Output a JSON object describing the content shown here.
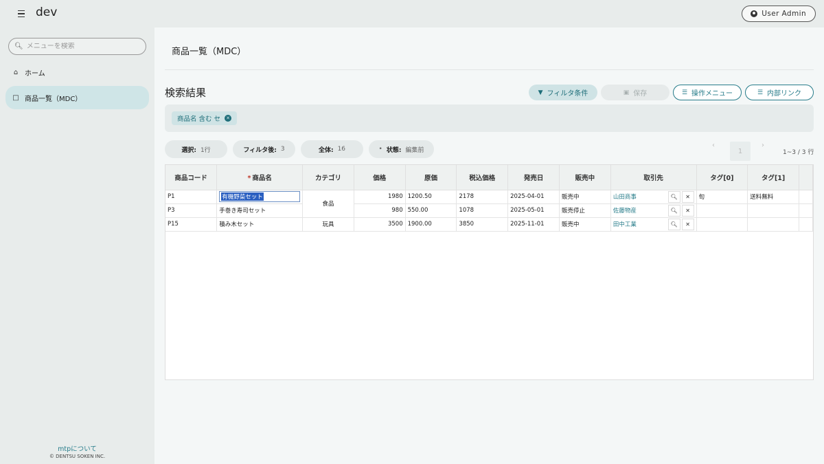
{
  "app": {
    "title": "dev",
    "user_label": "User Admin"
  },
  "sidebar": {
    "search_placeholder": "メニューを検索",
    "items": [
      {
        "label": "ホーム",
        "icon": "home-icon"
      },
      {
        "label": "商品一覧（MDC）",
        "icon": "document-icon",
        "active": true
      }
    ],
    "footer_link": "mtpについて",
    "copyright": "© DENTSU SOKEN INC."
  },
  "main": {
    "page_title": "商品一覧（MDC）",
    "section_title": "検索結果",
    "buttons": {
      "filter": "フィルタ条件",
      "save": "保存",
      "ops_menu": "操作メニュー",
      "internal_link": "内部リンク"
    },
    "filter_chip": "商品名 含む セ",
    "stats": {
      "selected_label": "選択:",
      "selected_value": "1行",
      "filtered_label": "フィルタ後:",
      "filtered_value": "3",
      "total_label": "全体:",
      "total_value": "16",
      "state_label": "状態:",
      "state_value": "編集前"
    },
    "pagination": {
      "prev": "‹",
      "page": "1",
      "next": "›",
      "info": "1~3 / 3 行"
    }
  },
  "table": {
    "headers": [
      "商品コード",
      "商品名",
      "カテゴリ",
      "価格",
      "原価",
      "税込価格",
      "発売日",
      "販売中",
      "取引先",
      "タグ[0]",
      "タグ[1]",
      ""
    ],
    "rows": [
      {
        "code": "P1",
        "name": "有機野菜セット",
        "category": "食品",
        "price": "1980",
        "cost": "1200.50",
        "tax_price": "2178",
        "release": "2025-04-01",
        "status": "販売中",
        "partner": "山田商事",
        "tag0": "旬",
        "tag1": "送料無料"
      },
      {
        "code": "P3",
        "name": "手巻き寿司セット",
        "category": "",
        "price": "980",
        "cost": "550.00",
        "tax_price": "1078",
        "release": "2025-05-01",
        "status": "販売停止",
        "partner": "佐藤物産",
        "tag0": "",
        "tag1": ""
      },
      {
        "code": "P15",
        "name": "積み木セット",
        "category": "玩具",
        "price": "3500",
        "cost": "1900.00",
        "tax_price": "3850",
        "release": "2025-11-01",
        "status": "販売中",
        "partner": "田中工業",
        "tag0": "",
        "tag1": ""
      }
    ]
  },
  "colors": {
    "accent": "#277c8a",
    "active_nav": "#cfe5e7",
    "required": "#c0392b"
  }
}
